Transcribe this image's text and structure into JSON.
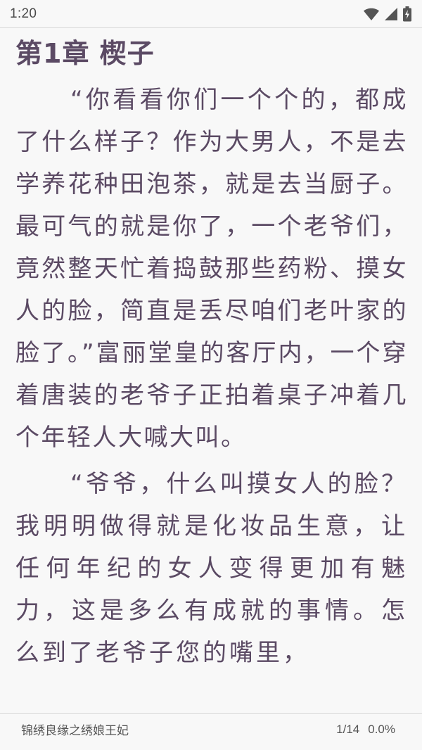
{
  "status_bar": {
    "time": "1:20",
    "icons": [
      "wifi-icon",
      "cellular-signal-icon",
      "battery-charging-icon"
    ]
  },
  "reader": {
    "chapter_title": "第1章 楔子",
    "paragraphs": [
      "“你看看你们一个个的，都成了什么样子？作为大男人，不是去学养花种田泡茶，就是去当厨子。最可气的就是你了，一个老爷们，竟然整天忙着捣鼓那些药粉、摸女人的脸，简直是丢尽咱们老叶家的脸了。”富丽堂皇的客厅内，一个穿着唐装的老爷子正拍着桌子冲着几个年轻人大喊大叫。",
      "“爷爷，什么叫摸女人的脸？我明明做得就是化妆品生意，让任何年纪的女人变得更加有魅力，这是多么有成就的事情。怎么到了老爷子您的嘴里，"
    ]
  },
  "footer": {
    "book_title": "锦绣良缘之绣娘王妃",
    "page_indicator": "1/14",
    "progress_percent": "0.0%"
  },
  "colors": {
    "background": "#f8f8f8",
    "text": "#5b4a64",
    "status_text": "#4a4a4a",
    "divider": "#d9d9d9"
  }
}
